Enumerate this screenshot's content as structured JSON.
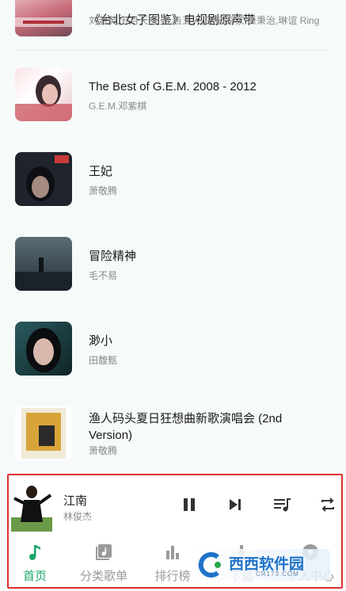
{
  "albums": [
    {
      "title": "《台北女子图鉴》电视剧原声带",
      "artist": "刘若英,五月天,丁当,告五人,白安,家家,萧秉治,琳谊 Ring",
      "cover_color": "#c86a78"
    },
    {
      "title": "The Best of G.E.M. 2008 - 2012",
      "artist": "G.E.M.邓紫棋",
      "cover_color": "#c94f5a"
    },
    {
      "title": "王妃",
      "artist": "萧敬腾",
      "cover_color": "#2b2f3a"
    },
    {
      "title": "冒险精神",
      "artist": "毛不易",
      "cover_color": "#2f3a44"
    },
    {
      "title": "渺小",
      "artist": "田馥甄",
      "cover_color": "#1a3a3e"
    },
    {
      "title": "渔人码头夏日狂想曲新歌演唱会 (2nd Version)",
      "artist": "萧敬腾",
      "cover_color": "#d8a43a"
    }
  ],
  "player": {
    "song": "江南",
    "singer": "林俊杰",
    "accent": "#1aa667"
  },
  "nav": {
    "items": [
      {
        "label": "首页",
        "icon": "music-note-icon",
        "active": true
      },
      {
        "label": "分类歌单",
        "icon": "playlist-album-icon",
        "active": false
      },
      {
        "label": "排行榜",
        "icon": "bar-chart-icon",
        "active": false
      },
      {
        "label": "下载",
        "icon": "download-icon",
        "active": false
      },
      {
        "label": "个人中心",
        "icon": "disc-icon",
        "active": false
      }
    ]
  },
  "watermark": {
    "text": "西西软件园",
    "sub": "CR173.COM"
  }
}
